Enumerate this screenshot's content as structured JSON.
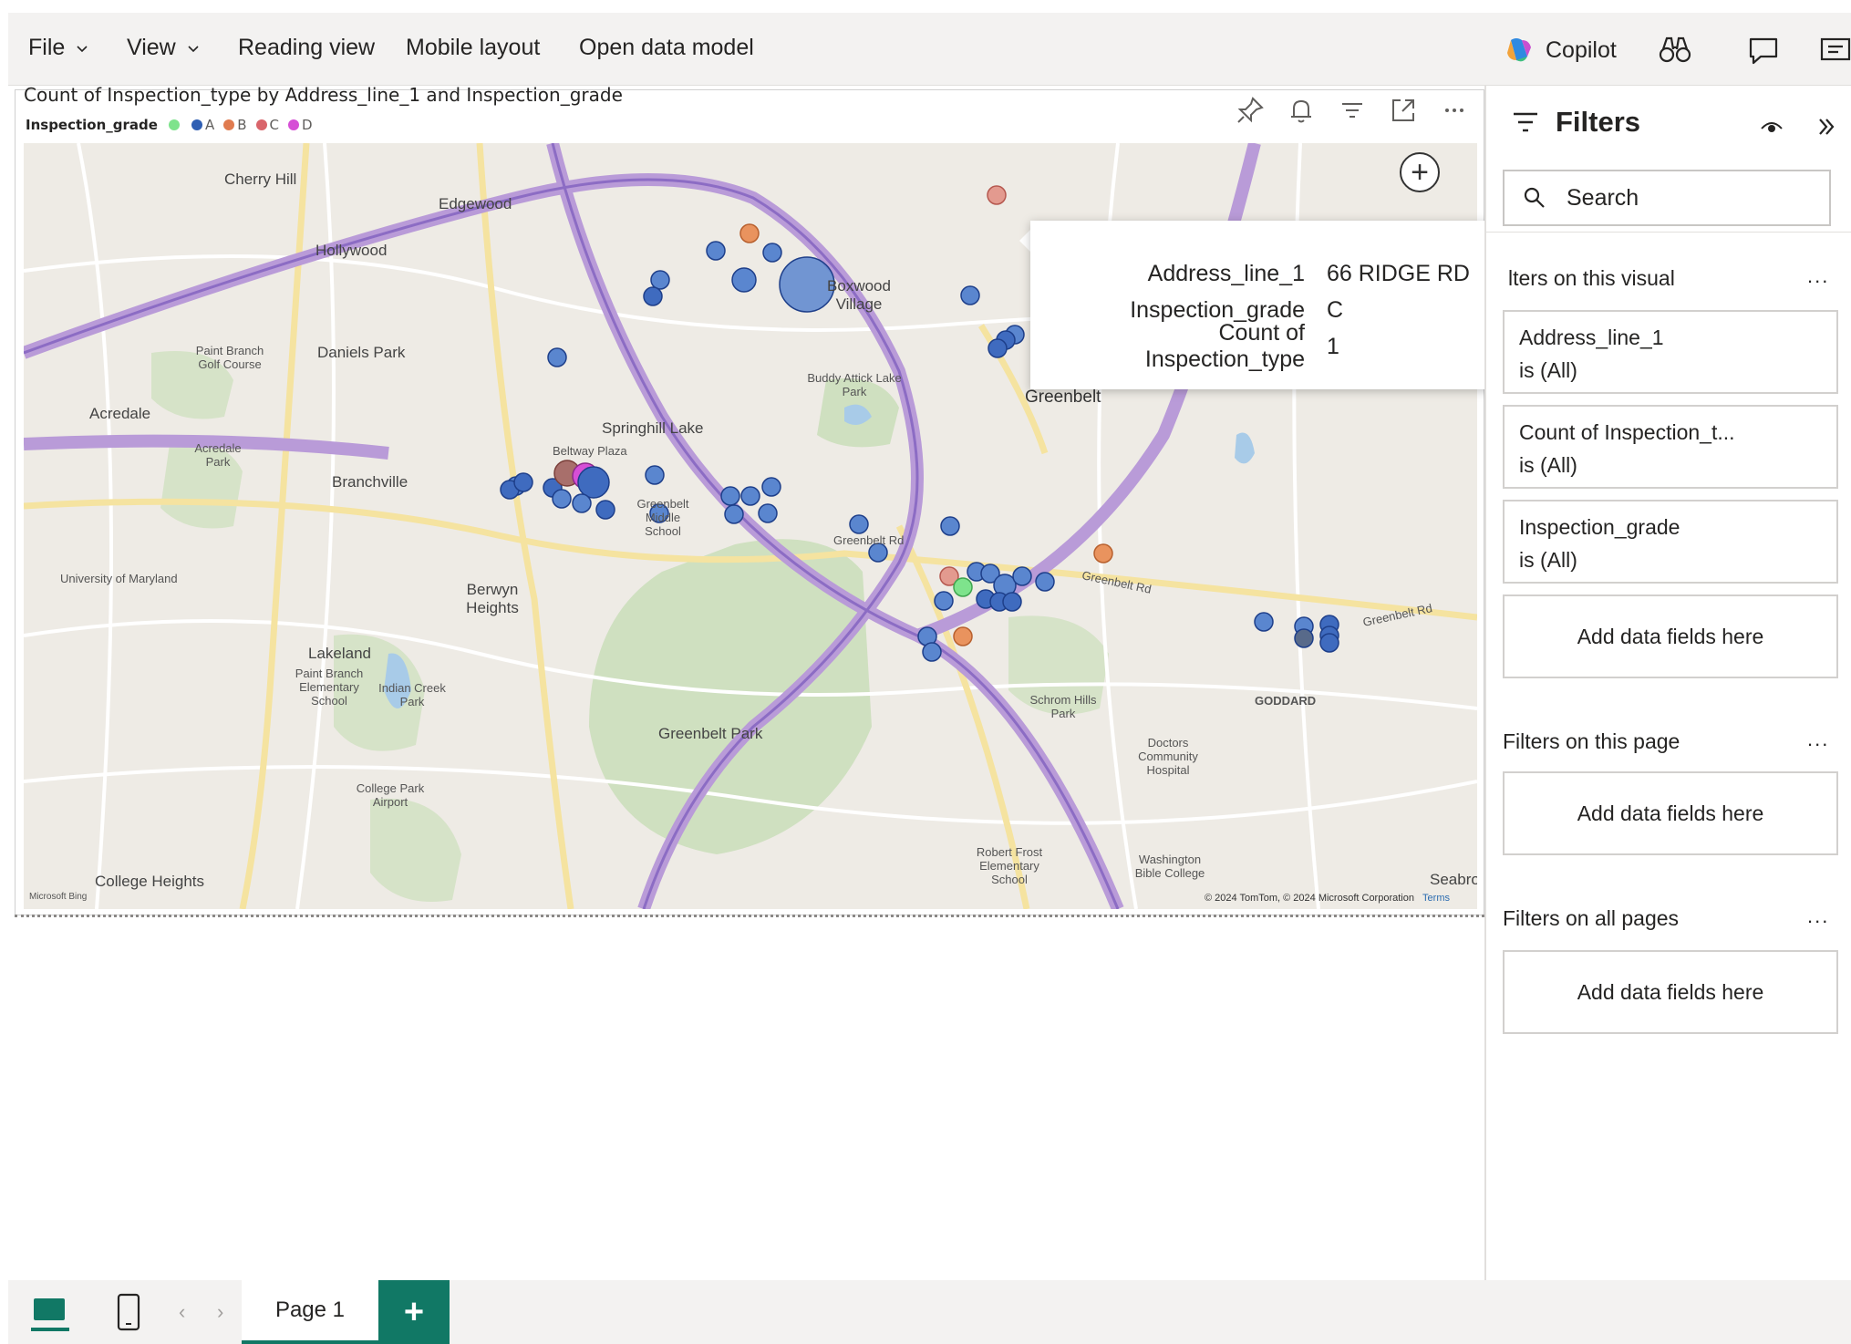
{
  "menubar": {
    "items": [
      {
        "label": "File",
        "has_dropdown": true
      },
      {
        "label": "View",
        "has_dropdown": true
      },
      {
        "label": "Reading view",
        "has_dropdown": false
      },
      {
        "label": "Mobile layout",
        "has_dropdown": false
      },
      {
        "label": "Open data model",
        "has_dropdown": false
      }
    ],
    "copilot_label": "Copilot",
    "tool_icons": [
      "binoculars-icon",
      "comment-icon",
      "present-icon"
    ]
  },
  "visual": {
    "title": "Count of Inspection_type by Address_line_1 and Inspection_grade",
    "legend_title": "Inspection_grade",
    "legend_items": [
      {
        "label": "",
        "color": "#7ee38c"
      },
      {
        "label": "A",
        "color": "#2f5fb3"
      },
      {
        "label": "B",
        "color": "#e07b4f"
      },
      {
        "label": "C",
        "color": "#d9656b"
      },
      {
        "label": "D",
        "color": "#d64fd6"
      }
    ],
    "header_icons": [
      "pin-icon",
      "bell-icon",
      "filter-icon",
      "focus-mode-icon",
      "more-options-icon"
    ]
  },
  "map": {
    "labels": [
      "Cherry Hill",
      "Edgewood",
      "Hollywood",
      "Daniels Park",
      "Paint Branch Golf Course",
      "Acredale",
      "Acredale Park",
      "Branchville",
      "University of Maryland",
      "Boxwood Village",
      "Springhill Lake",
      "Buddy Attick Lake Park",
      "Greenbelt",
      "Berwyn Heights",
      "Lakeland",
      "Paint Branch Elementary School",
      "Indian Creek Park",
      "College Park Airport",
      "Greenbelt Park",
      "Schrom Hills Park",
      "GODDARD",
      "Doctors Community Hospital",
      "Robert Frost Elementary School",
      "Washington Bible College",
      "College Heights",
      "Greenbelt Middle School",
      "Greenbelt Rd",
      "Beltway Plaza",
      "Seabrook"
    ],
    "attribution": "© 2024 TomTom, © 2024 Microsoft Corporation",
    "terms": "Terms",
    "bing": "Microsoft Bing"
  },
  "tooltip": {
    "rows": [
      {
        "key": "Address_line_1",
        "value": "66 RIDGE RD"
      },
      {
        "key": "Inspection_grade",
        "value": "C"
      },
      {
        "key": "Count of Inspection_type",
        "value": "1"
      }
    ]
  },
  "filters": {
    "title": "Filters",
    "search_placeholder": "Search",
    "sections": {
      "visual": {
        "title": "lters on this visual",
        "more": "..."
      },
      "page": {
        "title": "Filters on this page",
        "more": "..."
      },
      "all": {
        "title": "Filters on all pages",
        "more": "..."
      }
    },
    "visual_cards": [
      {
        "field": "Address_line_1",
        "state": "is (All)"
      },
      {
        "field": "Count of Inspection_t...",
        "state": "is (All)"
      },
      {
        "field": "Inspection_grade",
        "state": "is (All)"
      }
    ],
    "add_label": "Add data fields here"
  },
  "statusbar": {
    "page_tab": "Page 1",
    "add_page": "+"
  }
}
